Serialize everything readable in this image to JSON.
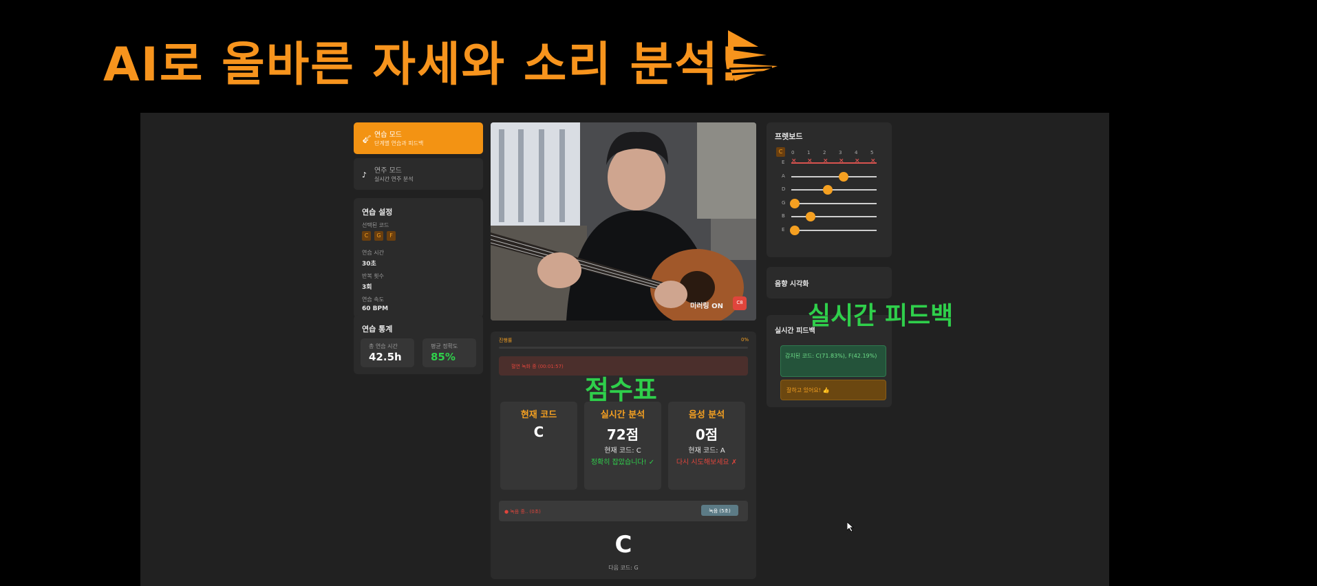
{
  "headline": "AI로 올바른 자세와 소리 분석!",
  "colors": {
    "accent": "#f39313",
    "overlay_green": "#2fcf4b",
    "rec_red": "#e0453c"
  },
  "tabs": [
    {
      "icon": "guitar-icon",
      "title": "연습 모드",
      "subtitle": "단계별 연습과 피드백"
    },
    {
      "icon": "music-note-icon",
      "title": "연주 모드",
      "subtitle": "실시간 연주 분석"
    }
  ],
  "practice_settings": {
    "title": "연습 설정",
    "chords_label": "선택된 코드",
    "chords": [
      "C",
      "G",
      "F"
    ],
    "time_label": "연습 시간",
    "time_value": "30초",
    "repeat_label": "반복 횟수",
    "repeat_value": "3회",
    "speed_label": "연습 속도",
    "speed_value": "60 BPM"
  },
  "practice_stats": {
    "title": "연습 통계",
    "total_label": "총 연습 시간",
    "total_value": "42.5h",
    "accuracy_label": "평균 정확도",
    "accuracy_value": "85%"
  },
  "video": {
    "mirror_label": "미러링 ON",
    "rec_label": "C8"
  },
  "progress": {
    "label": "진행률",
    "percent_label": "0%",
    "value": 0
  },
  "recording_banner": "혈연 녹화 중 (00:01:57)",
  "score_cards": [
    {
      "title": "현재 코드",
      "main": "C",
      "sub": "",
      "feedback": ""
    },
    {
      "title": "실시간 분석",
      "main": "72점",
      "sub": "현재 코드: C",
      "feedback": "정확히 잡았습니다! ✓"
    },
    {
      "title": "음성 분석",
      "main": "0점",
      "sub": "현재 코드: A",
      "feedback": "다시 시도해보세요 ✗"
    }
  ],
  "recording_bar": {
    "label": "● 녹음 중.. (0초)",
    "button_label": "녹음 (5초)"
  },
  "current_chord": {
    "chord": "C",
    "next_label": "다음 코드: G"
  },
  "fretboard": {
    "title": "프렛보드",
    "chord_badge": "C",
    "fret_numbers": [
      "0",
      "1",
      "2",
      "3",
      "4",
      "5"
    ],
    "strings": [
      "E",
      "A",
      "D",
      "G",
      "B",
      "E"
    ]
  },
  "sound_visual": {
    "title": "음향 시각화"
  },
  "realtime_feedback": {
    "title": "실시간 피드백",
    "detected": "감지된 코드: C(71.83%), F(42.19%)",
    "encourage": "잘하고 있어요! 👍"
  },
  "overlays": {
    "score_board": "점수표",
    "realtime_feedback": "실시간 피드백"
  }
}
